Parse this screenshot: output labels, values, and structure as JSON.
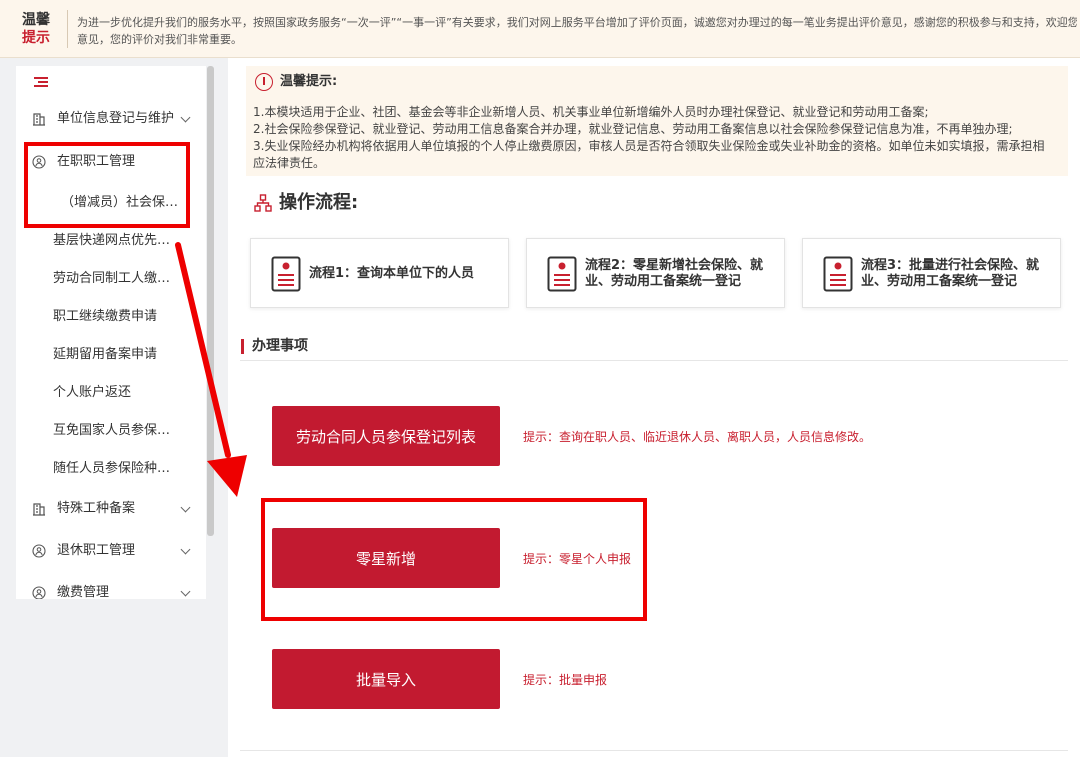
{
  "notice": {
    "tag_line1": "温馨",
    "tag_line2": "提示",
    "text_line1": "为进一步优化提升我们的服务水平，按照国家政务服务“一次一评”“一事一评”有关要求，我们对网上服务平台增加了评价页面，诚邀您对办理过的每一笔业务提出评价意见，感谢您的积极参与和支持，欢迎您提出宝贵",
    "text_line2": "意见，您的评价对我们非常重要。"
  },
  "sidebar": {
    "items": [
      {
        "label": "单位信息登记与维护",
        "icon": "building-icon"
      },
      {
        "label": "在职职工管理",
        "icon": "person-icon"
      },
      {
        "label": "特殊工种备案",
        "icon": "building-icon"
      },
      {
        "label": "退休职工管理",
        "icon": "person-icon"
      },
      {
        "label": "缴费管理",
        "icon": "person-icon"
      }
    ],
    "subitems": [
      "（增减员）社会保…",
      "基层快递网点优先…",
      "劳动合同制工人缴…",
      "职工继续缴费申请",
      "延期留用备案申请",
      "个人账户返还",
      "互免国家人员参保…",
      "随任人员参保险种…"
    ]
  },
  "tips": {
    "title": "温馨提示:",
    "lines": [
      "1.本模块适用于企业、社团、基金会等非企业新增人员、机关事业单位新增编外人员时办理社保登记、就业登记和劳动用工备案;",
      "2.社会保险参保登记、就业登记、劳动用工信息备案合并办理，就业登记信息、劳动用工备案信息以社会保险参保登记信息为准，不再单独办理;",
      "3.失业保险经办机构将依据用人单位填报的个人停止缴费原因，审核人员是否符合领取失业保险金或失业补助金的资格。如单位未如实填报，需承担相",
      "应法律责任。"
    ]
  },
  "flow": {
    "title": "操作流程:",
    "steps": [
      "流程1：查询本单位下的人员",
      "流程2：零星新增社会保险、就业、劳动用工备案统一登记",
      "流程3：批量进行社会保险、就业、劳动用工备案统一登记"
    ]
  },
  "section": {
    "title": "办理事项"
  },
  "actions": [
    {
      "label": "劳动合同人员参保登记列表",
      "hint": "提示：查询在职人员、临近退休人员、离职人员，人员信息修改。"
    },
    {
      "label": "零星新增",
      "hint": "提示：零星个人申报"
    },
    {
      "label": "批量导入",
      "hint": "提示：批量申报"
    }
  ],
  "colors": {
    "brand_red": "#c21a30",
    "annotation_red": "#ee0000",
    "tip_background": "#fdf6ec"
  }
}
